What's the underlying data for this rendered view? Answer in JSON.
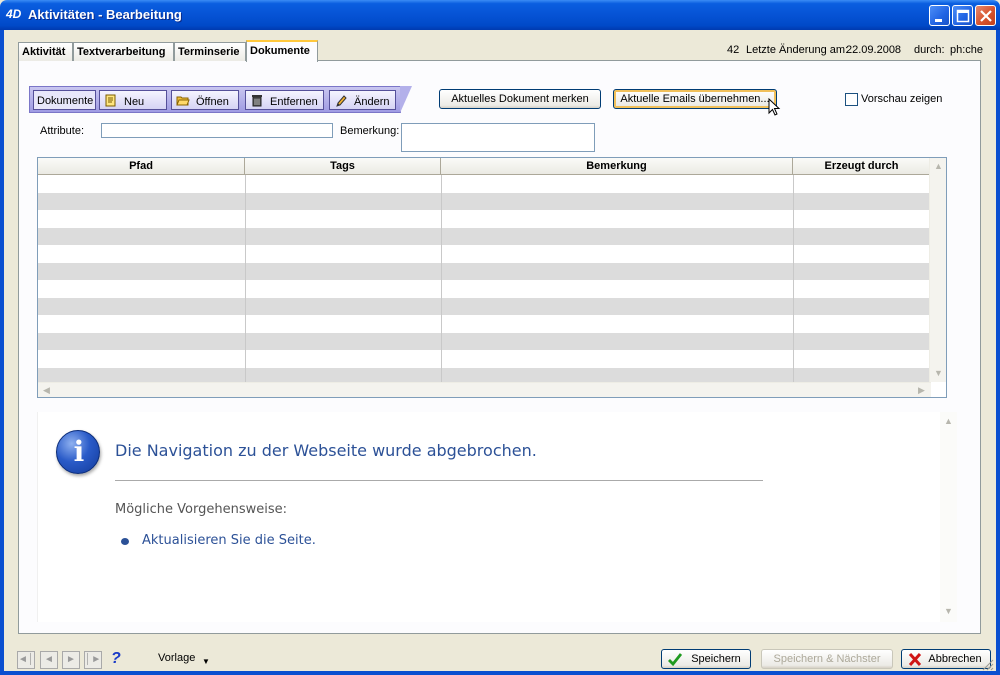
{
  "window": {
    "title": "Aktivitäten - Bearbeitung",
    "logo": "4D"
  },
  "tabs": [
    {
      "label": "Aktivität"
    },
    {
      "label": "Textverarbeitung"
    },
    {
      "label": "Terminserie"
    },
    {
      "label": "Dokumente"
    }
  ],
  "record": {
    "number": "42",
    "last_change_label": "Letzte Änderung am:",
    "last_change_date": "22.09.2008",
    "by_label": "durch:",
    "by_user": "ph:che"
  },
  "doc_toolbar": {
    "label": "Dokumente",
    "new": "Neu",
    "open": "Öffnen",
    "remove": "Entfernen",
    "edit": "Ändern"
  },
  "actions": {
    "remember_doc": "Aktuelles Dokument merken",
    "take_emails": "Aktuelle Emails übernehmen...",
    "preview": "Vorschau zeigen",
    "preview_checked": false
  },
  "fields": {
    "attribute_label": "Attribute:",
    "attribute_value": "",
    "remark_label": "Bemerkung:",
    "remark_value": ""
  },
  "table": {
    "columns": [
      "Pfad",
      "Tags",
      "Bemerkung",
      "Erzeugt durch"
    ],
    "rows": []
  },
  "web": {
    "heading": "Die Navigation zu der Webseite wurde abgebrochen.",
    "subheading": "Mögliche Vorgehensweise:",
    "link": "Aktualisieren Sie die Seite."
  },
  "footer": {
    "vorlage": "Vorlage",
    "help": "?",
    "save": "Speichern",
    "save_next": "Speichern & Nächster",
    "cancel": "Abbrechen"
  }
}
